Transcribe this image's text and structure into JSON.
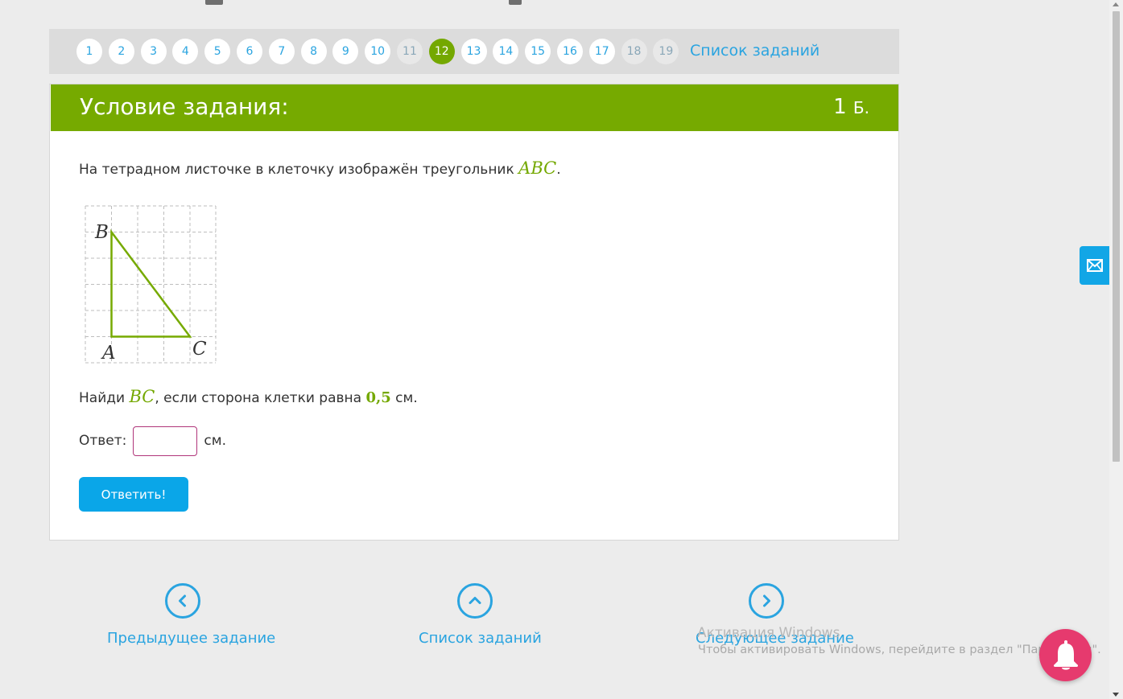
{
  "colors": {
    "accent_green": "#76aa00",
    "link_blue": "#2aa4e0",
    "button_blue": "#0aa6e8",
    "input_border": "#b0357a",
    "bell_pink": "#e63a6e"
  },
  "pager": {
    "items": [
      {
        "label": "1",
        "state": "default"
      },
      {
        "label": "2",
        "state": "default"
      },
      {
        "label": "3",
        "state": "default"
      },
      {
        "label": "4",
        "state": "default"
      },
      {
        "label": "5",
        "state": "default"
      },
      {
        "label": "6",
        "state": "default"
      },
      {
        "label": "7",
        "state": "default"
      },
      {
        "label": "8",
        "state": "default"
      },
      {
        "label": "9",
        "state": "default"
      },
      {
        "label": "10",
        "state": "default"
      },
      {
        "label": "11",
        "state": "visited"
      },
      {
        "label": "12",
        "state": "active"
      },
      {
        "label": "13",
        "state": "default"
      },
      {
        "label": "14",
        "state": "default"
      },
      {
        "label": "15",
        "state": "default"
      },
      {
        "label": "16",
        "state": "default"
      },
      {
        "label": "17",
        "state": "default"
      },
      {
        "label": "18",
        "state": "visited"
      },
      {
        "label": "19",
        "state": "visited"
      }
    ],
    "list_link": "Список заданий"
  },
  "task": {
    "header_title": "Условие задания:",
    "points_value": "1",
    "points_unit": "Б.",
    "statement_text": "На тетрадном листочке в клеточку изображён треугольник ",
    "statement_math": "ABC",
    "statement_end": ".",
    "vertex_labels": {
      "a": "A",
      "b": "B",
      "c": "C"
    },
    "question_prefix": "Найди ",
    "question_math": "BC",
    "question_middle": ", если сторона клетки равна ",
    "question_value": "0,5",
    "question_suffix": " см.",
    "answer_label": "Ответ:",
    "answer_value": "",
    "answer_unit": "см.",
    "submit_label": "Ответить!"
  },
  "bottom_nav": {
    "prev_label": "Предыдущее задание",
    "list_label": "Список заданий",
    "next_label": "Следующее задание"
  },
  "watermark": {
    "line1": "Активация Windows",
    "line2": "Чтобы активировать Windows, перейдите в раздел \"Параметры\"."
  },
  "icons": {
    "prev": "chevron-left-icon",
    "list": "chevron-up-icon",
    "next": "chevron-right-icon",
    "mail": "mail-icon",
    "bell": "bell-icon"
  }
}
